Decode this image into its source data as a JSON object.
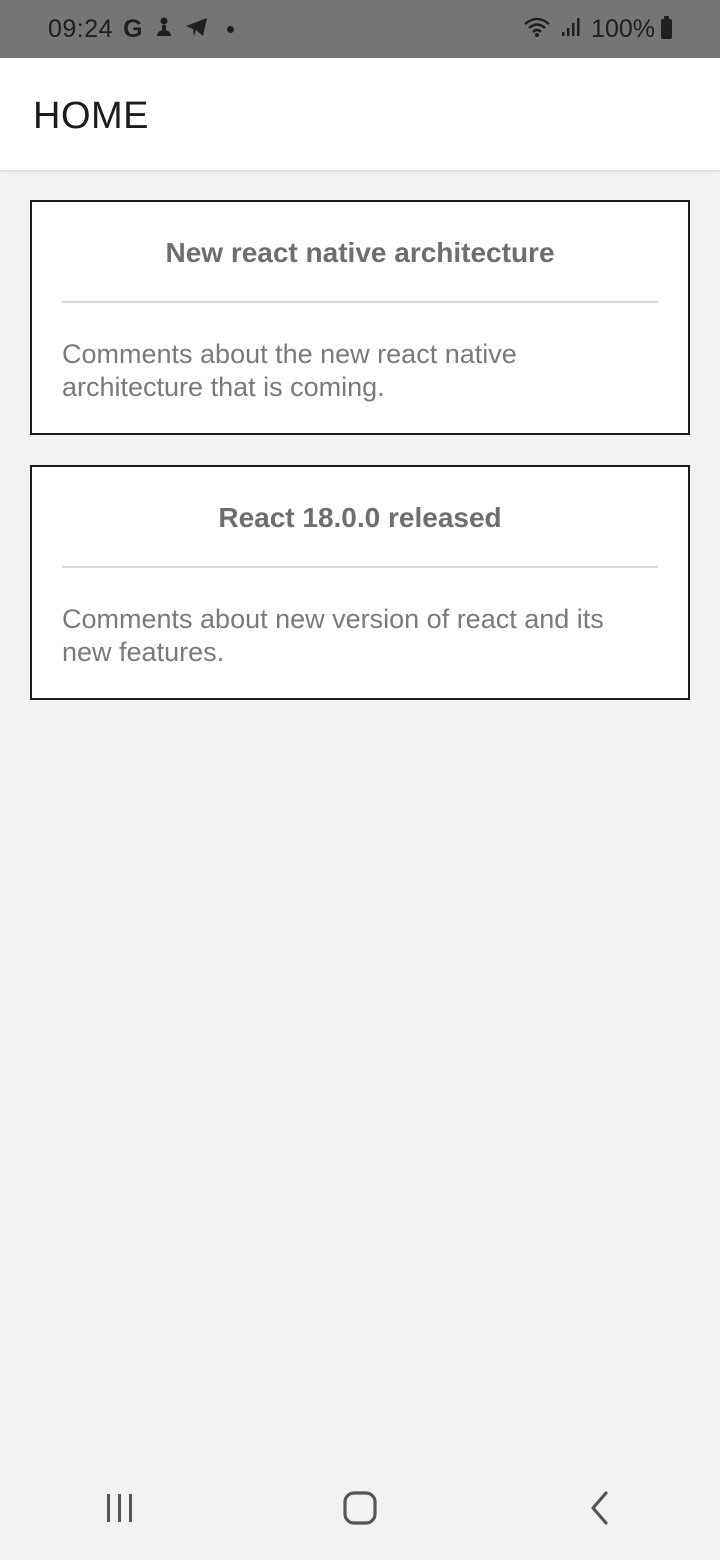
{
  "status_bar": {
    "time": "09:24",
    "g_label": "G",
    "battery_text": "100%",
    "icons": [
      "google-icon",
      "notification-icon",
      "telegram-icon",
      "dot-icon",
      "wifi-icon",
      "signal-icon",
      "battery-icon"
    ]
  },
  "header": {
    "title": "HOME"
  },
  "cards": [
    {
      "title": "New react native architecture",
      "body": "Comments about the new react native architecture that is coming."
    },
    {
      "title": "React 18.0.0 released",
      "body": "Comments about new version of react and its new features."
    }
  ],
  "nav_bar": {
    "icons": [
      "recent-apps-icon",
      "home-icon",
      "back-icon"
    ]
  },
  "colors": {
    "status_bar_bg": "#757575",
    "background": "#f2f2f2",
    "header_bg": "#ffffff",
    "card_border": "#1a1a1a",
    "card_text": "#6e6e6e"
  }
}
